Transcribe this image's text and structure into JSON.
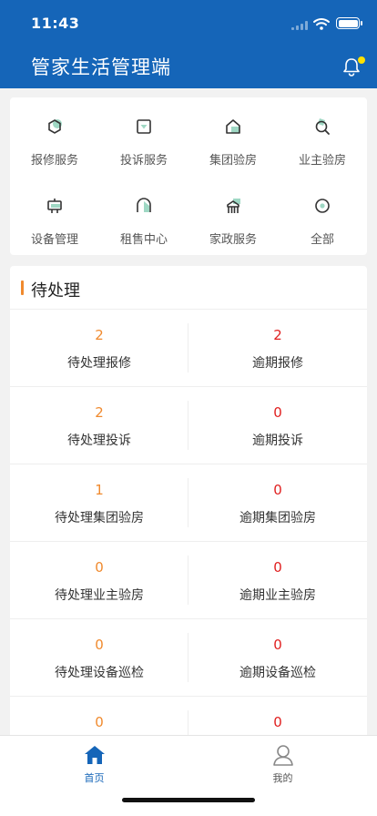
{
  "status_bar": {
    "time": "11:43"
  },
  "header": {
    "title": "管家生活管理端"
  },
  "services": [
    {
      "label": "报修服务",
      "icon": "repair-icon"
    },
    {
      "label": "投诉服务",
      "icon": "complaint-icon"
    },
    {
      "label": "集团验房",
      "icon": "group-inspection-icon"
    },
    {
      "label": "业主验房",
      "icon": "owner-inspection-icon"
    },
    {
      "label": "设备管理",
      "icon": "device-icon"
    },
    {
      "label": "租售中心",
      "icon": "rental-icon"
    },
    {
      "label": "家政服务",
      "icon": "housekeeping-icon"
    },
    {
      "label": "全部",
      "icon": "all-icon"
    }
  ],
  "pending": {
    "title": "待处理",
    "rows": [
      {
        "left": {
          "count": "2",
          "label": "待处理报修"
        },
        "right": {
          "count": "2",
          "label": "逾期报修"
        }
      },
      {
        "left": {
          "count": "2",
          "label": "待处理投诉"
        },
        "right": {
          "count": "0",
          "label": "逾期投诉"
        }
      },
      {
        "left": {
          "count": "1",
          "label": "待处理集团验房"
        },
        "right": {
          "count": "0",
          "label": "逾期集团验房"
        }
      },
      {
        "left": {
          "count": "0",
          "label": "待处理业主验房"
        },
        "right": {
          "count": "0",
          "label": "逾期业主验房"
        }
      },
      {
        "left": {
          "count": "0",
          "label": "待处理设备巡检"
        },
        "right": {
          "count": "0",
          "label": "逾期设备巡检"
        }
      },
      {
        "left": {
          "count": "0",
          "label": ""
        },
        "right": {
          "count": "0",
          "label": ""
        }
      }
    ]
  },
  "tabbar": {
    "home_label": "首页",
    "mine_label": "我的",
    "active_color": "#1565b8",
    "inactive_color": "#555555"
  },
  "colors": {
    "brand": "#1565b8",
    "pending_accent": "#f08a2e",
    "overdue": "#e02020",
    "icon_accent": "#9fd8c4",
    "notification_dot": "#ffe100"
  }
}
